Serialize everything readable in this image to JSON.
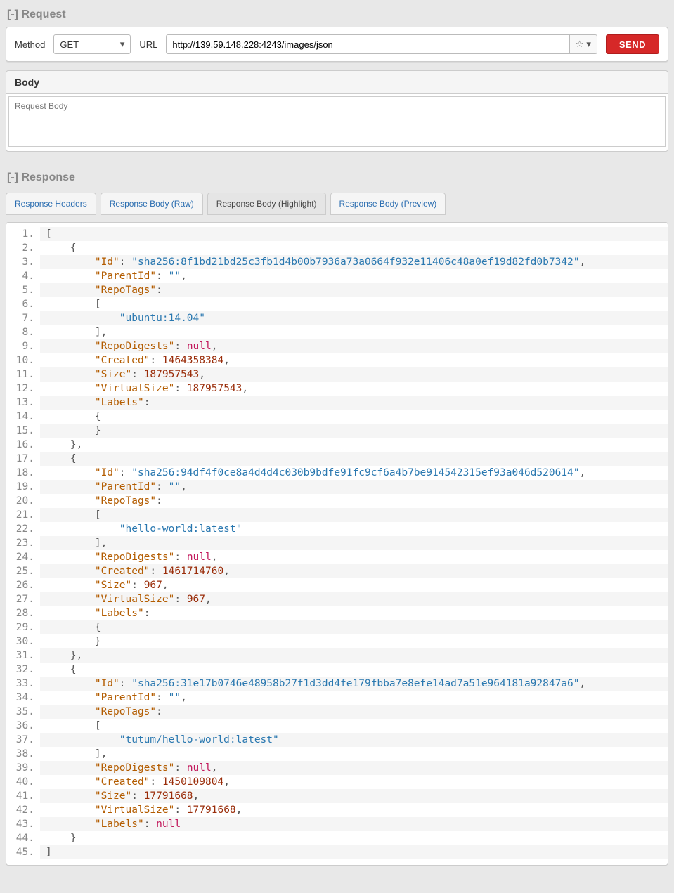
{
  "request": {
    "header_toggle": "[-]",
    "header_label": "Request",
    "method_label": "Method",
    "method_value": "GET",
    "url_label": "URL",
    "url_value": "http://139.59.148.228:4243/images/json",
    "send_label": "SEND",
    "body_title": "Body",
    "body_placeholder": "Request Body"
  },
  "response": {
    "header_toggle": "[-]",
    "header_label": "Response",
    "tabs": {
      "headers": "Response Headers",
      "raw": "Response Body (Raw)",
      "highlight": "Response Body (Highlight)",
      "preview": "Response Body (Preview)"
    },
    "code_lines": [
      [
        [
          "p",
          "["
        ]
      ],
      [
        [
          "p",
          "    {"
        ]
      ],
      [
        [
          "p",
          "        "
        ],
        [
          "k",
          "\"Id\""
        ],
        [
          "p",
          ": "
        ],
        [
          "s",
          "\"sha256:8f1bd21bd25c3fb1d4b00b7936a73a0664f932e11406c48a0ef19d82fd0b7342\""
        ],
        [
          "p",
          ","
        ]
      ],
      [
        [
          "p",
          "        "
        ],
        [
          "k",
          "\"ParentId\""
        ],
        [
          "p",
          ": "
        ],
        [
          "s",
          "\"\""
        ],
        [
          "p",
          ","
        ]
      ],
      [
        [
          "p",
          "        "
        ],
        [
          "k",
          "\"RepoTags\""
        ],
        [
          "p",
          ":"
        ]
      ],
      [
        [
          "p",
          "        ["
        ]
      ],
      [
        [
          "p",
          "            "
        ],
        [
          "s",
          "\"ubuntu:14.04\""
        ]
      ],
      [
        [
          "p",
          "        ],"
        ]
      ],
      [
        [
          "p",
          "        "
        ],
        [
          "k",
          "\"RepoDigests\""
        ],
        [
          "p",
          ": "
        ],
        [
          "nl",
          "null"
        ],
        [
          "p",
          ","
        ]
      ],
      [
        [
          "p",
          "        "
        ],
        [
          "k",
          "\"Created\""
        ],
        [
          "p",
          ": "
        ],
        [
          "n",
          "1464358384"
        ],
        [
          "p",
          ","
        ]
      ],
      [
        [
          "p",
          "        "
        ],
        [
          "k",
          "\"Size\""
        ],
        [
          "p",
          ": "
        ],
        [
          "n",
          "187957543"
        ],
        [
          "p",
          ","
        ]
      ],
      [
        [
          "p",
          "        "
        ],
        [
          "k",
          "\"VirtualSize\""
        ],
        [
          "p",
          ": "
        ],
        [
          "n",
          "187957543"
        ],
        [
          "p",
          ","
        ]
      ],
      [
        [
          "p",
          "        "
        ],
        [
          "k",
          "\"Labels\""
        ],
        [
          "p",
          ":"
        ]
      ],
      [
        [
          "p",
          "        {"
        ]
      ],
      [
        [
          "p",
          "        }"
        ]
      ],
      [
        [
          "p",
          "    },"
        ]
      ],
      [
        [
          "p",
          "    {"
        ]
      ],
      [
        [
          "p",
          "        "
        ],
        [
          "k",
          "\"Id\""
        ],
        [
          "p",
          ": "
        ],
        [
          "s",
          "\"sha256:94df4f0ce8a4d4d4c030b9bdfe91fc9cf6a4b7be914542315ef93a046d520614\""
        ],
        [
          "p",
          ","
        ]
      ],
      [
        [
          "p",
          "        "
        ],
        [
          "k",
          "\"ParentId\""
        ],
        [
          "p",
          ": "
        ],
        [
          "s",
          "\"\""
        ],
        [
          "p",
          ","
        ]
      ],
      [
        [
          "p",
          "        "
        ],
        [
          "k",
          "\"RepoTags\""
        ],
        [
          "p",
          ":"
        ]
      ],
      [
        [
          "p",
          "        ["
        ]
      ],
      [
        [
          "p",
          "            "
        ],
        [
          "s",
          "\"hello-world:latest\""
        ]
      ],
      [
        [
          "p",
          "        ],"
        ]
      ],
      [
        [
          "p",
          "        "
        ],
        [
          "k",
          "\"RepoDigests\""
        ],
        [
          "p",
          ": "
        ],
        [
          "nl",
          "null"
        ],
        [
          "p",
          ","
        ]
      ],
      [
        [
          "p",
          "        "
        ],
        [
          "k",
          "\"Created\""
        ],
        [
          "p",
          ": "
        ],
        [
          "n",
          "1461714760"
        ],
        [
          "p",
          ","
        ]
      ],
      [
        [
          "p",
          "        "
        ],
        [
          "k",
          "\"Size\""
        ],
        [
          "p",
          ": "
        ],
        [
          "n",
          "967"
        ],
        [
          "p",
          ","
        ]
      ],
      [
        [
          "p",
          "        "
        ],
        [
          "k",
          "\"VirtualSize\""
        ],
        [
          "p",
          ": "
        ],
        [
          "n",
          "967"
        ],
        [
          "p",
          ","
        ]
      ],
      [
        [
          "p",
          "        "
        ],
        [
          "k",
          "\"Labels\""
        ],
        [
          "p",
          ":"
        ]
      ],
      [
        [
          "p",
          "        {"
        ]
      ],
      [
        [
          "p",
          "        }"
        ]
      ],
      [
        [
          "p",
          "    },"
        ]
      ],
      [
        [
          "p",
          "    {"
        ]
      ],
      [
        [
          "p",
          "        "
        ],
        [
          "k",
          "\"Id\""
        ],
        [
          "p",
          ": "
        ],
        [
          "s",
          "\"sha256:31e17b0746e48958b27f1d3dd4fe179fbba7e8efe14ad7a51e964181a92847a6\""
        ],
        [
          "p",
          ","
        ]
      ],
      [
        [
          "p",
          "        "
        ],
        [
          "k",
          "\"ParentId\""
        ],
        [
          "p",
          ": "
        ],
        [
          "s",
          "\"\""
        ],
        [
          "p",
          ","
        ]
      ],
      [
        [
          "p",
          "        "
        ],
        [
          "k",
          "\"RepoTags\""
        ],
        [
          "p",
          ":"
        ]
      ],
      [
        [
          "p",
          "        ["
        ]
      ],
      [
        [
          "p",
          "            "
        ],
        [
          "s",
          "\"tutum/hello-world:latest\""
        ]
      ],
      [
        [
          "p",
          "        ],"
        ]
      ],
      [
        [
          "p",
          "        "
        ],
        [
          "k",
          "\"RepoDigests\""
        ],
        [
          "p",
          ": "
        ],
        [
          "nl",
          "null"
        ],
        [
          "p",
          ","
        ]
      ],
      [
        [
          "p",
          "        "
        ],
        [
          "k",
          "\"Created\""
        ],
        [
          "p",
          ": "
        ],
        [
          "n",
          "1450109804"
        ],
        [
          "p",
          ","
        ]
      ],
      [
        [
          "p",
          "        "
        ],
        [
          "k",
          "\"Size\""
        ],
        [
          "p",
          ": "
        ],
        [
          "n",
          "17791668"
        ],
        [
          "p",
          ","
        ]
      ],
      [
        [
          "p",
          "        "
        ],
        [
          "k",
          "\"VirtualSize\""
        ],
        [
          "p",
          ": "
        ],
        [
          "n",
          "17791668"
        ],
        [
          "p",
          ","
        ]
      ],
      [
        [
          "p",
          "        "
        ],
        [
          "k",
          "\"Labels\""
        ],
        [
          "p",
          ": "
        ],
        [
          "nl",
          "null"
        ]
      ],
      [
        [
          "p",
          "    }"
        ]
      ],
      [
        [
          "p",
          "]"
        ]
      ]
    ]
  }
}
